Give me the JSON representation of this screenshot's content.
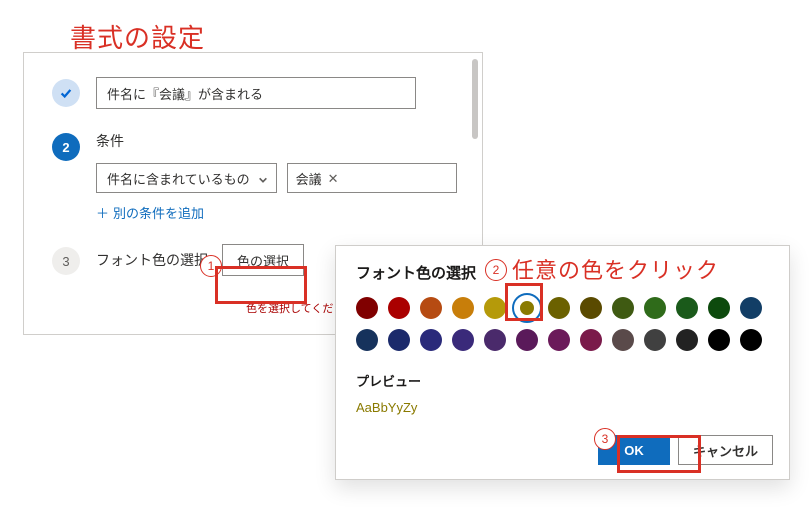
{
  "annotations": {
    "title": "書式の設定",
    "n1": "1",
    "n2": "2",
    "n3": "3",
    "hint": "任意の色をクリック"
  },
  "left": {
    "rule_summary": "件名に『会議』が含まれる",
    "step2_num": "2",
    "step2_title": "条件",
    "cond_field": "件名に含まれているもの",
    "cond_value": "会議",
    "add_condition": "別の条件を追加",
    "step3_num": "3",
    "step3_title": "フォント色の選択",
    "choose_color_btn": "色の選択",
    "error": "色を選択してください。"
  },
  "popup": {
    "title": "フォント色の選択",
    "preview_label": "プレビュー",
    "preview_sample": "AaBbYyZy",
    "ok": "OK",
    "cancel": "キャンセル",
    "selected_index": 5,
    "colors": [
      "#800000",
      "#aa0000",
      "#b64b12",
      "#c87e0a",
      "#b59a0a",
      "#8a7a00",
      "#6b6100",
      "#5a4a00",
      "#3f5a12",
      "#2f6b1a",
      "#1a5a1a",
      "#0d4a0d",
      "#123e66",
      "#16325c",
      "#1b2a6b",
      "#2a2a7a",
      "#3a2a7a",
      "#4a2a6b",
      "#5a1a5a",
      "#6b1a5a",
      "#7a1a4a",
      "#5a4a4a",
      "#404040",
      "#222222",
      "#000000",
      "#000000"
    ]
  }
}
